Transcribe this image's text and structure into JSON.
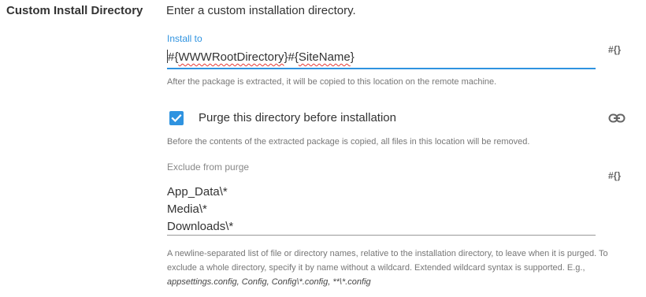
{
  "section": {
    "label": "Custom Install Directory",
    "description": "Enter a custom installation directory."
  },
  "install_to": {
    "label": "Install to",
    "value_parts": [
      "#{",
      "WWWRootDirectory",
      "}#{",
      "SiteName",
      "}"
    ],
    "hint": "After the package is extracted, it will be copied to this location on the remote machine.",
    "variable_button": "#{}"
  },
  "purge": {
    "checked": true,
    "label": "Purge this directory before installation",
    "hint": "Before the contents of the extracted package is copied, all files in this location will be removed.",
    "link_icon": "link-icon"
  },
  "exclude": {
    "label": "Exclude from purge",
    "lines": [
      "App_Data\\*",
      "Media\\*",
      "Downloads\\*"
    ],
    "variable_button": "#{}",
    "hint_text": "A newline-separated list of file or directory names, relative to the installation directory, to leave when it is purged. To exclude a whole directory, specify it by name without a wildcard. Extended wildcard syntax is supported. E.g., ",
    "hint_examples": "appsettings.config, Config, Config\\*.config, **\\*.config"
  },
  "colors": {
    "accent": "#2f93e0",
    "text": "#333333",
    "hint": "#777777",
    "spellcheck": "#e53935"
  }
}
